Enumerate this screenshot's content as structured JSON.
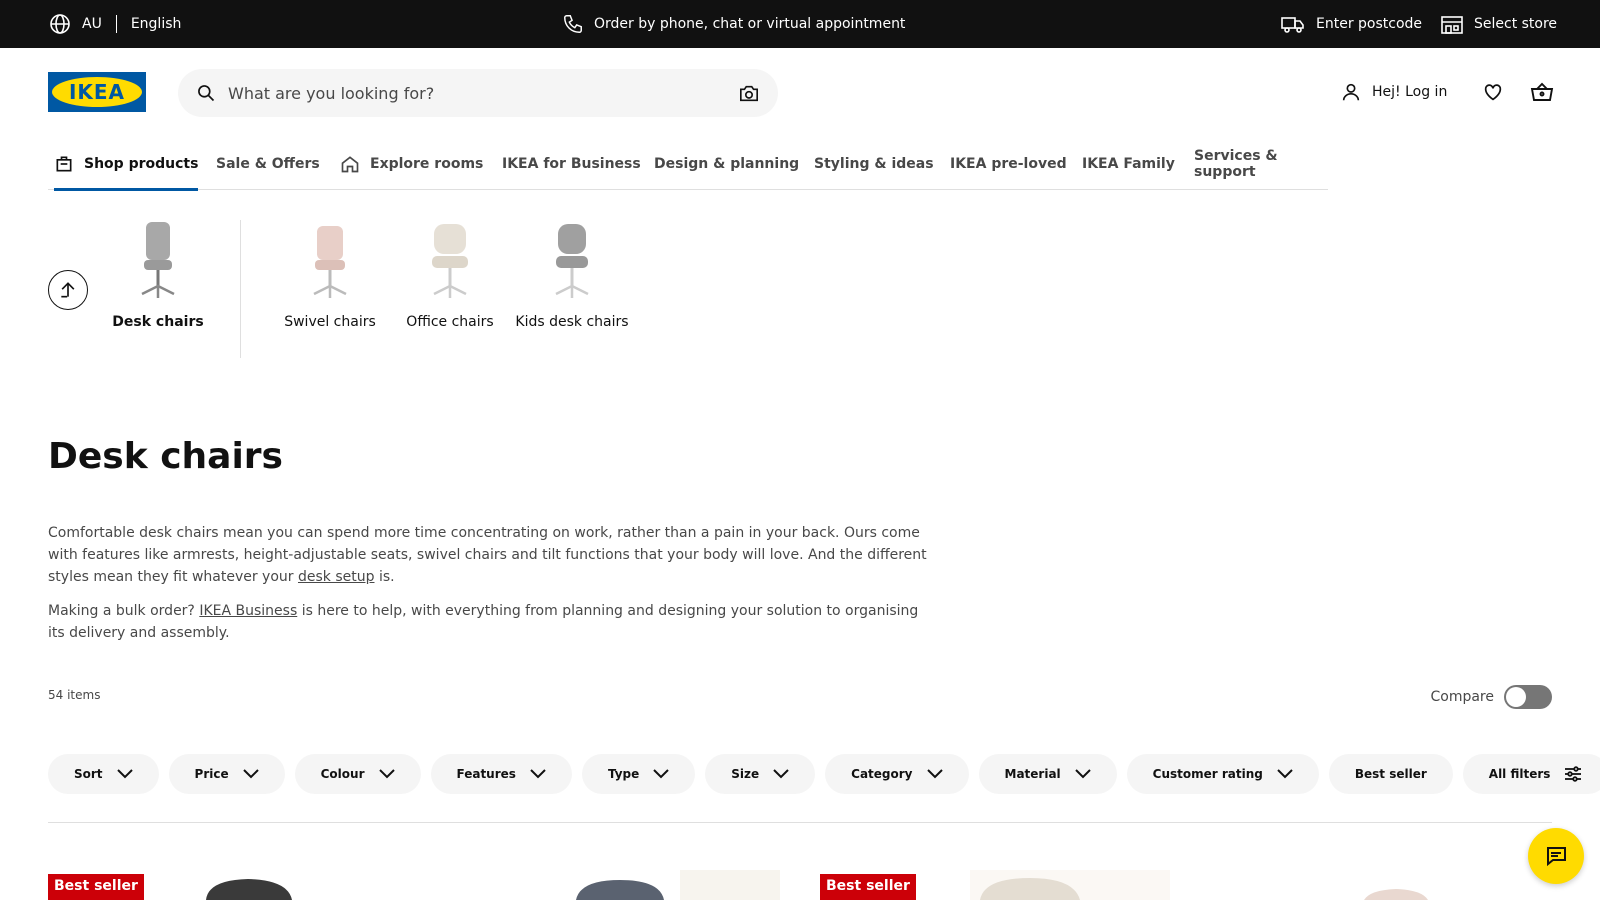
{
  "topbar": {
    "region": "AU",
    "language": "English",
    "order_text": "Order by phone, chat or virtual appointment",
    "postcode_text": "Enter postcode",
    "store_text": "Select store"
  },
  "header": {
    "logo_text": "IKEA",
    "search_placeholder": "What are you looking for?",
    "login_text": "Hej! Log in"
  },
  "nav": {
    "tabs": [
      {
        "label": "Shop products",
        "active": true
      },
      {
        "label": "Sale & Offers"
      },
      {
        "label": "Explore rooms"
      },
      {
        "label": "IKEA for Business"
      },
      {
        "label": "Design & planning"
      },
      {
        "label": "Styling & ideas"
      },
      {
        "label": "IKEA pre-loved"
      },
      {
        "label": "IKEA Family"
      },
      {
        "label": "Services & support"
      }
    ]
  },
  "categories": {
    "current": "Desk chairs",
    "items": [
      "Swivel chairs",
      "Office chairs",
      "Kids desk chairs"
    ]
  },
  "page": {
    "title": "Desk chairs",
    "desc1_a": "Comfortable desk chairs mean you can spend more time concentrating on work, rather than a pain in your back. Ours come with features like armrests, height-adjustable seats, swivel chairs and tilt functions that your body will love. And the different styles mean they fit whatever your ",
    "desc1_link": "desk setup",
    "desc1_b": " is.",
    "desc2_a": "Making a bulk order? ",
    "desc2_link": "IKEA Business",
    "desc2_b": " is here to help, with everything from planning and designing your solution to organising its delivery and assembly.",
    "item_count": "54 items",
    "compare_label": "Compare"
  },
  "filters": {
    "sort": "Sort",
    "price": "Price",
    "colour": "Colour",
    "features": "Features",
    "type": "Type",
    "size": "Size",
    "category": "Category",
    "material": "Material",
    "customer_rating": "Customer rating",
    "best_seller": "Best seller",
    "all_filters": "All filters"
  },
  "products": {
    "badge1": "Best seller",
    "badge2": "Best seller"
  },
  "colors": {
    "brand_blue": "#0058a3",
    "brand_yellow": "#ffdb00",
    "badge_red": "#cc0008"
  }
}
